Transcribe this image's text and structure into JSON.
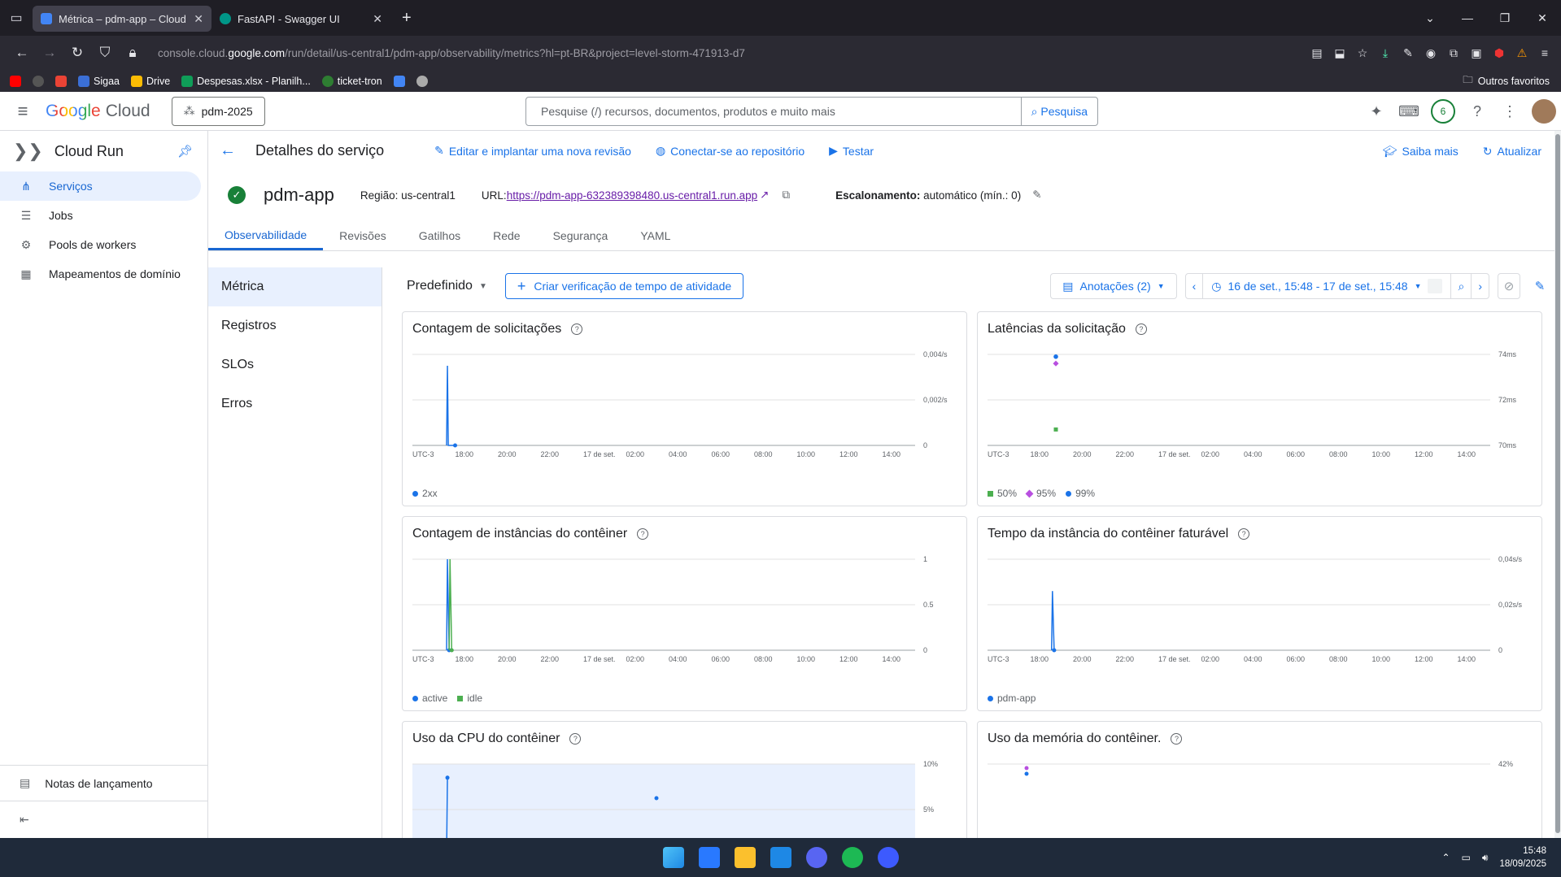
{
  "browser": {
    "tabs": [
      {
        "title": "Métrica – pdm-app – Cloud Run",
        "active": true
      },
      {
        "title": "FastAPI - Swagger UI",
        "active": false
      }
    ],
    "url_prefix": "console.cloud.",
    "url_domain": "google.com",
    "url_path": "/run/detail/us-central1/pdm-app/observability/metrics?hl=pt-BR&project=level-storm-471913-d7",
    "bookmarks": [
      "Sigaa",
      "Drive",
      "Despesas.xlsx - Planilh...",
      "ticket-tron"
    ],
    "other_bookmarks": "Outros favoritos"
  },
  "header": {
    "logo_google": "Google",
    "logo_cloud": "Cloud",
    "project": "pdm-2025",
    "search_placeholder": "Pesquise (/) recursos, documentos, produtos e muito mais",
    "search_button": "Pesquisa",
    "notification_count": "6"
  },
  "sidebar": {
    "title": "Cloud Run",
    "items": [
      {
        "label": "Serviços",
        "icon": "services-icon"
      },
      {
        "label": "Jobs",
        "icon": "jobs-icon"
      },
      {
        "label": "Pools de workers",
        "icon": "workers-icon"
      },
      {
        "label": "Mapeamentos de domínio",
        "icon": "domain-icon"
      }
    ],
    "release_notes": "Notas de lançamento"
  },
  "toolbar": {
    "title": "Detalhes do serviço",
    "edit": "Editar e implantar uma nova revisão",
    "connect": "Conectar-se ao repositório",
    "test": "Testar",
    "learn": "Saiba mais",
    "refresh": "Atualizar"
  },
  "service": {
    "name": "pdm-app",
    "region": "Região: us-central1",
    "url_label": "URL:",
    "url": "https://pdm-app-632389398480.us-central1.run.app",
    "scale_label": "Escalonamento:",
    "scale_value": " automático (mín.: 0)"
  },
  "tabs": [
    "Observabilidade",
    "Revisões",
    "Gatilhos",
    "Rede",
    "Segurança",
    "YAML"
  ],
  "subnav": [
    "Métrica",
    "Registros",
    "SLOs",
    "Erros"
  ],
  "filters": {
    "preset": "Predefinido",
    "create_uptime": "Criar verificação de tempo de atividade",
    "annotations": "Anotações (2)",
    "time_range": "16 de set., 15:48 - 17 de set., 15:48"
  },
  "x_ticks": [
    "UTC-3",
    "18:00",
    "20:00",
    "22:00",
    "17 de set.",
    "02:00",
    "04:00",
    "06:00",
    "08:00",
    "10:00",
    "12:00",
    "14:00"
  ],
  "chart_data": [
    {
      "type": "line",
      "title": "Contagem de solicitações",
      "yticks": [
        "0,004/s",
        "0,002/s",
        "0"
      ],
      "ylim": [
        0,
        0.004
      ],
      "series": [
        {
          "name": "2xx",
          "points": [
            [
              0.8,
              0
            ],
            [
              0.82,
              0.0035
            ],
            [
              0.84,
              0
            ],
            [
              1.0,
              0
            ]
          ],
          "color": "#1a73e8"
        }
      ]
    },
    {
      "type": "scatter",
      "title": "Latências da solicitação",
      "yticks": [
        "74ms",
        "72ms",
        "70ms"
      ],
      "ylim": [
        70,
        74
      ],
      "series": [
        {
          "name": "50%",
          "points": [
            [
              1.6,
              70.7
            ]
          ],
          "color": "#4caf50"
        },
        {
          "name": "95%",
          "points": [
            [
              1.6,
              73.6
            ]
          ],
          "color": "#b84fe0"
        },
        {
          "name": "99%",
          "points": [
            [
              1.6,
              73.9
            ]
          ],
          "color": "#1a73e8"
        }
      ]
    },
    {
      "type": "line",
      "title": "Contagem de instâncias do contêiner",
      "yticks": [
        "1",
        "0.5",
        "0"
      ],
      "ylim": [
        0,
        1
      ],
      "series": [
        {
          "name": "active",
          "points": [
            [
              0.8,
              0
            ],
            [
              0.82,
              1
            ],
            [
              0.86,
              0
            ]
          ],
          "color": "#1a73e8"
        },
        {
          "name": "idle",
          "points": [
            [
              0.86,
              0
            ],
            [
              0.88,
              1
            ],
            [
              0.92,
              0
            ]
          ],
          "color": "#4caf50"
        }
      ]
    },
    {
      "type": "line",
      "title": "Tempo da instância do contêiner faturável",
      "yticks": [
        "0,04s/s",
        "0,02s/s",
        "0"
      ],
      "ylim": [
        0,
        0.04
      ],
      "series": [
        {
          "name": "pdm-app",
          "points": [
            [
              1.5,
              0
            ],
            [
              1.52,
              0.026
            ],
            [
              1.56,
              0
            ]
          ],
          "color": "#1a73e8"
        }
      ]
    },
    {
      "type": "line",
      "title": "Uso da CPU do contêiner",
      "yticks": [
        "10%",
        "5%"
      ],
      "ylim": [
        0,
        10
      ],
      "series": [
        {
          "name": "",
          "points": [
            [
              0.8,
              0
            ],
            [
              0.82,
              8.5
            ]
          ],
          "color": "#1a73e8"
        }
      ]
    },
    {
      "type": "scatter",
      "title": "Uso da memória do contêiner.",
      "yticks": [
        "42%"
      ],
      "ylim": [
        40,
        42
      ],
      "series": []
    }
  ],
  "taskbar": {
    "time": "15:48",
    "date": "18/09/2025"
  }
}
